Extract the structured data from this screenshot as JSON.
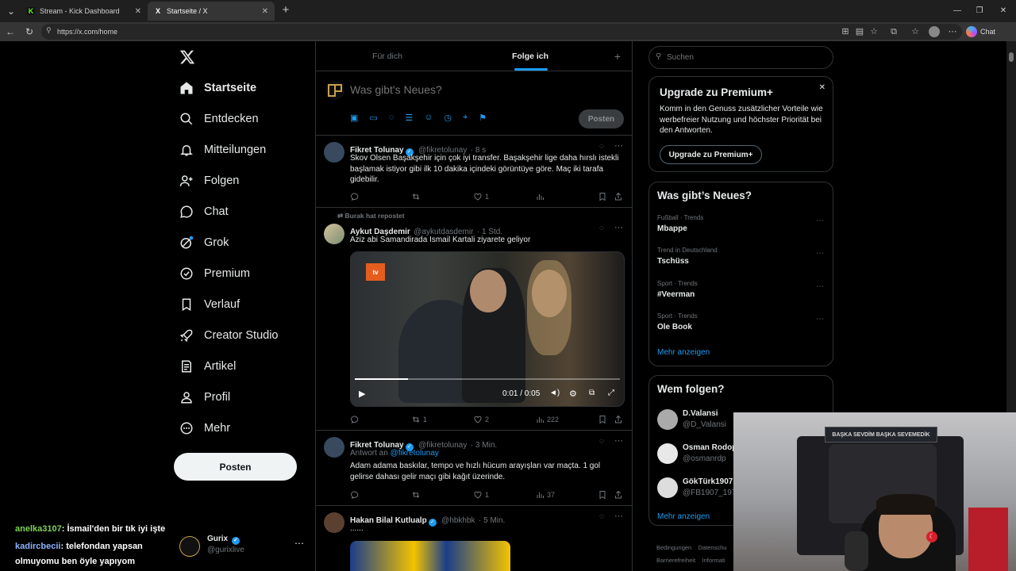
{
  "browser": {
    "tabs": [
      {
        "title": "Stream - Kick Dashboard",
        "favicon": "K"
      },
      {
        "title": "Startseite / X",
        "favicon": "X"
      }
    ],
    "url": "https://x.com/home",
    "chat_label": "Chat"
  },
  "nav": {
    "items": [
      {
        "label": "Startseite",
        "icon": "home-icon"
      },
      {
        "label": "Entdecken",
        "icon": "search-icon"
      },
      {
        "label": "Mitteilungen",
        "icon": "bell-icon"
      },
      {
        "label": "Folgen",
        "icon": "follow-icon"
      },
      {
        "label": "Chat",
        "icon": "chat-icon"
      },
      {
        "label": "Grok",
        "icon": "grok-icon"
      },
      {
        "label": "Premium",
        "icon": "premium-icon"
      },
      {
        "label": "Verlauf",
        "icon": "bookmark-icon"
      },
      {
        "label": "Creator Studio",
        "icon": "rocket-icon"
      },
      {
        "label": "Artikel",
        "icon": "article-icon"
      },
      {
        "label": "Profil",
        "icon": "profile-icon"
      },
      {
        "label": "Mehr",
        "icon": "more-icon"
      }
    ],
    "post_button": "Posten",
    "account": {
      "name": "Gurix",
      "handle": "@gurixlive"
    }
  },
  "feed": {
    "tabs": [
      "Für dich",
      "Folge ich"
    ],
    "composer": {
      "placeholder": "Was gibt's Neues?",
      "post": "Posten"
    },
    "tweets": [
      {
        "name": "Fikret Tolunay",
        "handle": "@fikretolunay",
        "time": "· 8 s",
        "text": "Skov Olsen Başakşehir için çok iyi transfer. Başakşehir lige daha hırslı istekli başlamak istiyor gibi ilk 10 dakika içindeki görüntüye göre. Maç iki tarafa gidebilir.",
        "replies": "",
        "reposts": "",
        "likes": "1",
        "views": ""
      },
      {
        "repost_by": "Burak hat repostet",
        "name": "Aykut Daşdemir",
        "handle": "@aykutdasdemir",
        "time": "· 1 Std.",
        "text": "Aziz abi Samandirada Ismail Kartali ziyarete geliyor",
        "video_time": "0:01 / 0:05",
        "video_progress": 0.2,
        "video_logo": "tv",
        "replies": "",
        "reposts": "1",
        "likes": "2",
        "views": "222"
      },
      {
        "name": "Fikret Tolunay",
        "handle": "@fikretolunay",
        "time": "· 3 Min.",
        "reply_to_prefix": "Antwort an",
        "reply_to": "@fikretolunay",
        "text": "Adam adama baskılar, tempo ve hızlı hücum arayışları var maçta. 1 gol gelirse dahası gelir maçı gibi kağıt üzerinde.",
        "replies": "",
        "reposts": "",
        "likes": "1",
        "views": "37"
      },
      {
        "name": "Hakan Bilal Kutlualp",
        "handle": "@hbkhbk",
        "time": "· 5 Min.",
        "text": "......"
      }
    ]
  },
  "sidebar": {
    "search_placeholder": "Suchen",
    "premium": {
      "title": "Upgrade zu Premium+",
      "text": "Komm in den Genuss zusätzlicher Vorteile wie werbefreier Nutzung und höchster Priorität bei den Antworten.",
      "button": "Upgrade zu Premium+"
    },
    "trends": {
      "title": "Was gibt’s Neues?",
      "items": [
        {
          "meta": "Fußball · Trends",
          "name": "Mbappe"
        },
        {
          "meta": "Trend in Deutschland",
          "name": "Tschüss"
        },
        {
          "meta": "Sport · Trends",
          "name": "#Veerman"
        },
        {
          "meta": "Sport · Trends",
          "name": "Ole Book"
        }
      ],
      "more": "Mehr anzeigen"
    },
    "who_to_follow": {
      "title": "Wem folgen?",
      "users": [
        {
          "name": "D.Valansi",
          "handle": "@D_Valansi"
        },
        {
          "name": "Osman Rodop",
          "handle": "@osmanrdp"
        },
        {
          "name": "GökTürk1907",
          "handle": "@FB1907_1974"
        }
      ],
      "more": "Mehr anzeigen"
    },
    "footer": [
      "Bedingungen",
      "Datenschu",
      "Barrierefreiheit",
      "Informati"
    ]
  },
  "stream_chat": [
    {
      "user": "anelka3107",
      "user_color": "#7dd35a",
      "message": ": İsmail'den bir tık iyi işte"
    },
    {
      "user": "kadircbecii",
      "user_color": "#8ab4ff",
      "message": ": telefondan yapsan"
    },
    {
      "user": "",
      "user_color": "#ffffff",
      "message": "olmuyomu ben öyle yapıyom"
    }
  ],
  "webcam": {
    "banner": "BAŞKA SEVDİM BAŞKA SEVEMEDİK"
  }
}
